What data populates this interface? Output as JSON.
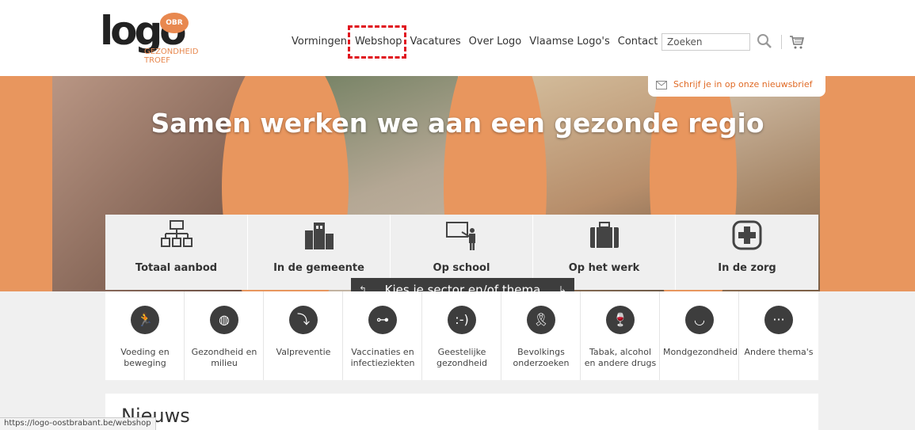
{
  "header": {
    "logo_word": "logo",
    "logo_badge": "OBR",
    "logo_sub_line1": "GEZONDHEID",
    "logo_sub_line2": "TROEF",
    "nav": [
      "Vormingen",
      "Webshop",
      "Vacatures",
      "Over Logo",
      "Vlaamse Logo's",
      "Contact"
    ],
    "search_placeholder": "Zoeken"
  },
  "hero": {
    "title": "Samen werken we aan een gezonde regio",
    "newsletter": "Schrijf je in op onze nieuwsbrief"
  },
  "sectors": [
    {
      "label": "Totaal aanbod",
      "icon": "network-icon"
    },
    {
      "label": "In de gemeente",
      "icon": "buildings-icon"
    },
    {
      "label": "Op school",
      "icon": "teacher-board-icon"
    },
    {
      "label": "Op het werk",
      "icon": "briefcase-icon"
    },
    {
      "label": "In de zorg",
      "icon": "plus-cross-icon"
    }
  ],
  "kies": "Kies je sector en/of thema",
  "themes": [
    {
      "label": "Voeding en beweging",
      "icon": "runner-apple-icon"
    },
    {
      "label": "Gezondheid en milieu",
      "icon": "globe-icon"
    },
    {
      "label": "Valpreventie",
      "icon": "falling-person-icon"
    },
    {
      "label": "Vaccinaties en infectieziekten",
      "icon": "syringe-icon"
    },
    {
      "label": "Geestelijke gezondheid",
      "icon": "smiley-icon"
    },
    {
      "label": "Bevolkings onderzoeken",
      "icon": "ribbon-icon"
    },
    {
      "label": "Tabak, alcohol en andere drugs",
      "icon": "cigarette-glass-icon"
    },
    {
      "label": "Mondgezondheid",
      "icon": "tooth-icon"
    },
    {
      "label": "Andere thema's",
      "icon": "more-dots-icon"
    }
  ],
  "news": {
    "title": "Nieuws"
  },
  "status_url": "https://logo-oostbrabant.be/webshop",
  "colors": {
    "accent": "#e8965e",
    "highlight": "#e0141e",
    "dark": "#3d3d3d"
  }
}
